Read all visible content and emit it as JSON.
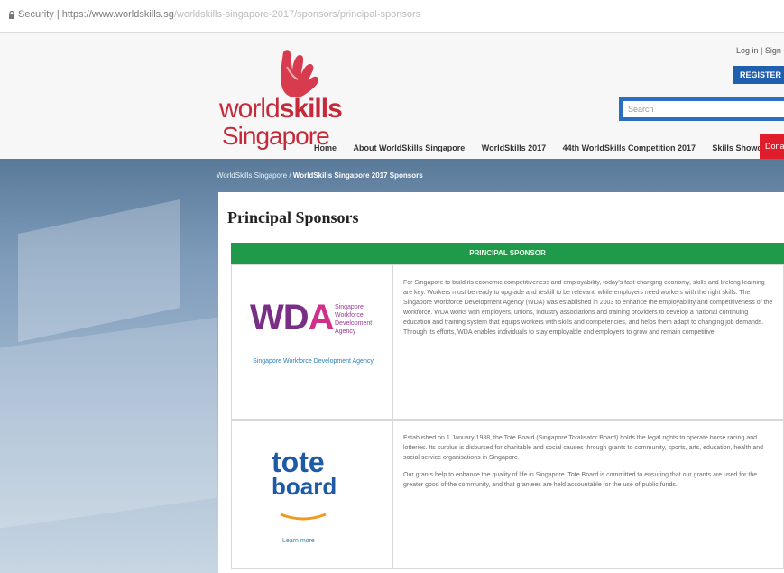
{
  "browser": {
    "security_label": "Security",
    "url_host": "https://www.worldskills.sg",
    "url_path": "/worldskills-singapore-2017/sponsors/principal-sponsors"
  },
  "header": {
    "logo_line1_a": "world",
    "logo_line1_b": "skills",
    "logo_line2": "Singapore",
    "login_link": "Log in | Sign up",
    "register_button": "REGISTER NOW",
    "search_placeholder": "Search"
  },
  "nav": {
    "items": [
      "Home",
      "About WorldSkills Singapore",
      "WorldSkills 2017",
      "44th WorldSkills Competition 2017",
      "Skills Showcase"
    ],
    "red_item": "Donate"
  },
  "breadcrumb": {
    "root": "WorldSkills Singapore",
    "sep": " / ",
    "current": "WorldSkills Singapore 2017 Sponsors"
  },
  "page": {
    "title": "Principal Sponsors",
    "section_header": "PRINCIPAL SPONSOR"
  },
  "sponsors": [
    {
      "logo_word_a": "WD",
      "logo_word_b": "A",
      "logo_side": [
        "Singapore",
        "Workforce",
        "Development",
        "Agency"
      ],
      "caption": "Singapore Workforce Development Agency",
      "description": "For Singapore to build its economic competitiveness and employability, today's fast-changing economy, skills and lifelong learning are key. Workers must be ready to upgrade and reskill to be relevant, while employers need workers with the right skills. The Singapore Workforce Development Agency (WDA) was established in 2003 to enhance the employability and competitiveness of the workforce. WDA works with employers, unions, industry associations and training providers to develop a national continuing education and training system that equips workers with skills and competencies, and helps them adapt to changing job demands. Through its efforts, WDA enables individuals to stay employable and employers to grow and remain competitive."
    },
    {
      "logo_word_a": "tote",
      "logo_word_b": "board",
      "link_text": "Learn more",
      "description_p1": "Established on 1 January 1988, the Tote Board (Singapore Totalisator Board) holds the legal rights to operate horse racing and lotteries. Its surplus is disbursed for charitable and social causes through grants to community, sports, arts, education, health and social service organisations in Singapore.",
      "description_p2": "Our grants help to enhance the quality of life in Singapore. Tote Board is committed to ensuring that our grants are used for the greater good of the community, and that grantees are held accountable for the use of public funds."
    }
  ],
  "colors": {
    "brand_red": "#c62a3a",
    "nav_blue": "#1f5fae",
    "section_green": "#1f9a4a",
    "wda_purple": "#7a2f87",
    "tote_blue": "#1d5aa8"
  }
}
